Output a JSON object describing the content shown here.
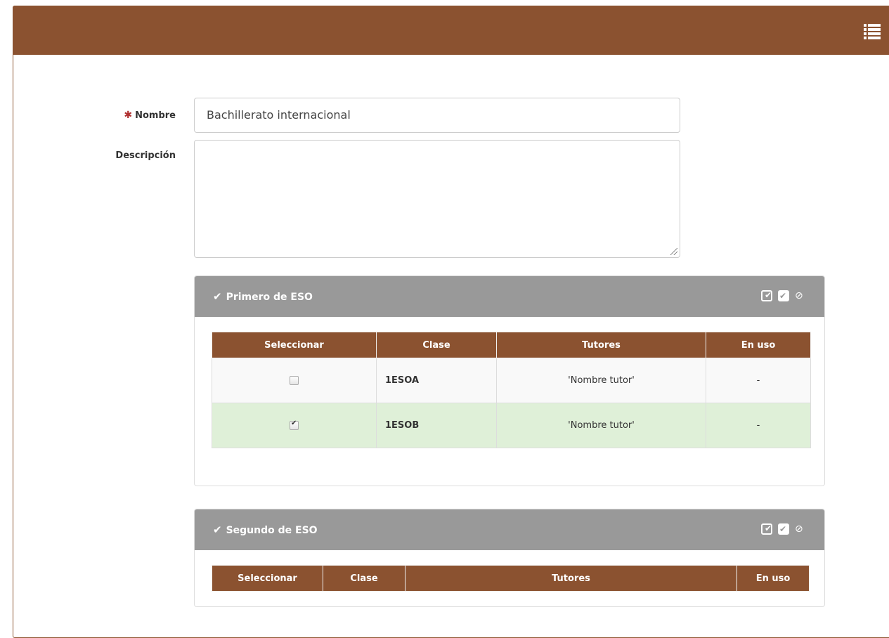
{
  "form": {
    "nombre_label": "Nombre",
    "nombre_required": "✱",
    "nombre_value": "Bachillerato internacional",
    "descripcion_label": "Descripción",
    "descripcion_value": ""
  },
  "panels": [
    {
      "title": "Primero de ESO",
      "headers": [
        "Seleccionar",
        "Clase",
        "Tutores",
        "En uso"
      ],
      "rows": [
        {
          "checked": false,
          "clase": "1ESOA",
          "tutores": "'Nombre tutor'",
          "en_uso": "-"
        },
        {
          "checked": true,
          "clase": "1ESOB",
          "tutores": "'Nombre tutor'",
          "en_uso": "-"
        }
      ]
    },
    {
      "title": "Segundo de ESO",
      "headers": [
        "Seleccionar",
        "Clase",
        "Tutores",
        "En uso"
      ],
      "rows": []
    }
  ],
  "icons": {
    "menu": "list-icon",
    "panel_check": "checkmark-icon",
    "select_all": "check-square-outline-icon",
    "select_all_filled": "check-square-icon",
    "hide": "eye-slash-icon"
  },
  "colors": {
    "brand": "#8b5230",
    "panel_header": "#999999",
    "selected_row": "#dff0d8",
    "required": "#b03030"
  }
}
